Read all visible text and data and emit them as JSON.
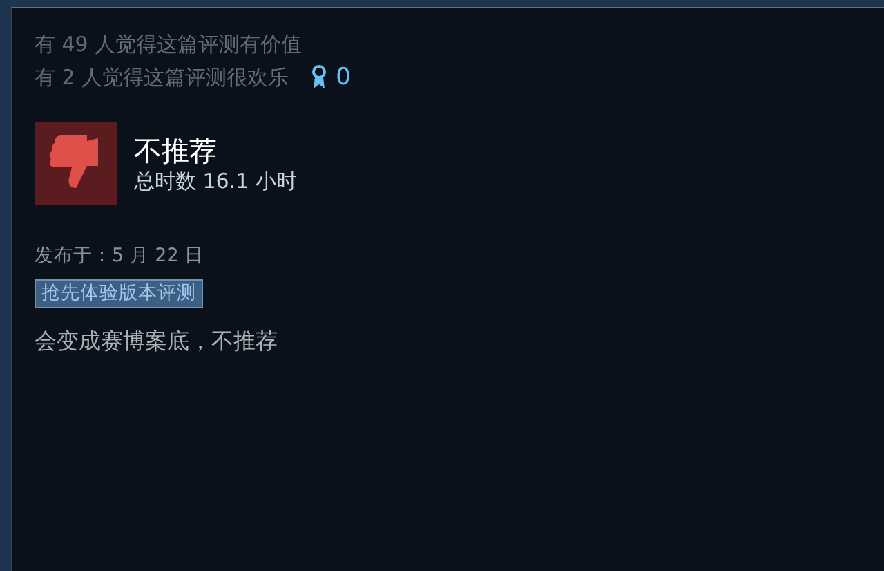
{
  "helpful": {
    "useful_text": "有 49 人觉得这篇评测有价值",
    "funny_text": "有 2 人觉得这篇评测很欢乐",
    "awards": "0"
  },
  "review": {
    "recommended": false,
    "verdict": "不推荐",
    "playtime": "总时数 16.1 小时",
    "posted": "发布于：5 月 22 日",
    "tag": "抢先体验版本评测",
    "body": "会变成赛博案底，不推荐"
  }
}
